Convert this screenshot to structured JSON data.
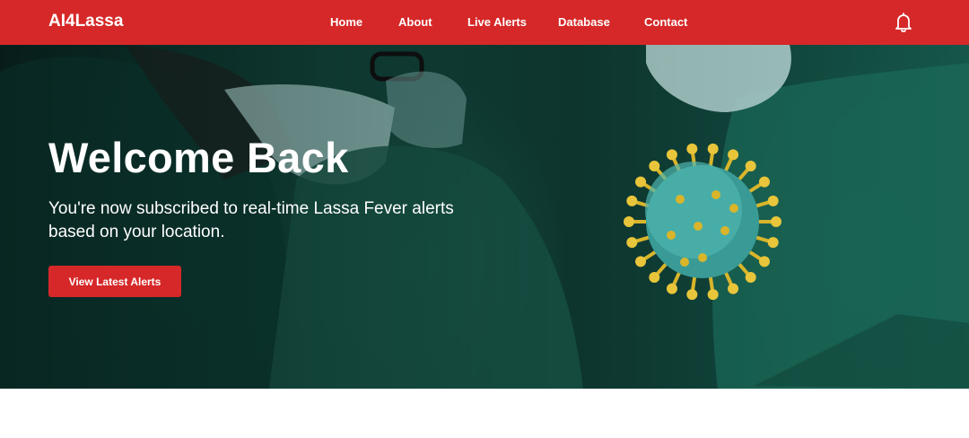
{
  "brand": "AI4Lassa",
  "nav": {
    "items": [
      {
        "label": "Home"
      },
      {
        "label": "About"
      },
      {
        "label": "Live Alerts"
      },
      {
        "label": "Database"
      },
      {
        "label": "Contact"
      }
    ],
    "bell_icon": "bell-icon"
  },
  "hero": {
    "title": "Welcome Back",
    "subtitle": "You're now subscribed to real-time Lassa Fever alerts based on your location.",
    "cta_label": "View Latest Alerts",
    "image": "surgeons-background",
    "virus_image": "virus-illustration"
  },
  "colors": {
    "brand_red": "#d62828",
    "text_light": "#ffffff"
  }
}
